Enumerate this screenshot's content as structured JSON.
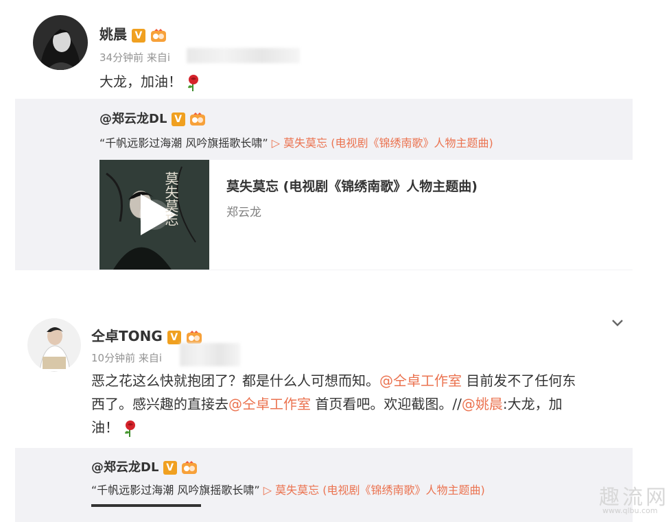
{
  "post1": {
    "author": "姚晨",
    "verified_mark": "V",
    "time": "34分钟前",
    "source_prefix": "来自",
    "source_partial": "i",
    "content": "大龙，加油！",
    "quote": {
      "author": "@郑云龙DL",
      "verified_mark": "V",
      "text": "“千帆远影过海潮  风吟旗摇歌长啸”",
      "music_link": "▷ 莫失莫忘 (电视剧《锦绣南歌》人物主题曲)"
    },
    "media": {
      "title": "莫失莫忘 (电视剧《锦绣南歌》人物主题曲)",
      "artist": "郑云龙",
      "cover_caption": "莫失莫忘"
    }
  },
  "post2": {
    "author": "仝卓TONG",
    "verified_mark": "V",
    "time": "10分钟前",
    "source_prefix": "来自",
    "source_partial": "i",
    "content_line1_a": "恶之花这么快就抱团了？都是什么人可想而知。",
    "mention1": "@仝卓工作室",
    "content_line1_b": " 目前发不了任何东",
    "content_line2_a": "西了。感兴趣的直接去",
    "mention2": "@仝卓工作室",
    "content_line2_b": " 首页看吧。欢迎截图。//",
    "mention3": "@姚晨",
    "content_line2_c": ":大龙，加",
    "content_line3": "油！",
    "quote": {
      "author": "@郑云龙DL",
      "verified_mark": "V",
      "text": "“千帆远影过海潮  风吟旗摇歌长啸”",
      "music_link": "▷ 莫失莫忘 (电视剧《锦绣南歌》人物主题曲)"
    }
  },
  "watermark": {
    "text": "趣流网",
    "url": "www.qlbu.com"
  },
  "colors": {
    "link": "#eb7350",
    "verified": "#f0a020",
    "quote_bg": "#f2f2f5"
  },
  "icons": [
    "rose-emoji-icon",
    "verified-v-icon",
    "fan-badge-icon",
    "play-icon",
    "chevron-down-icon"
  ]
}
